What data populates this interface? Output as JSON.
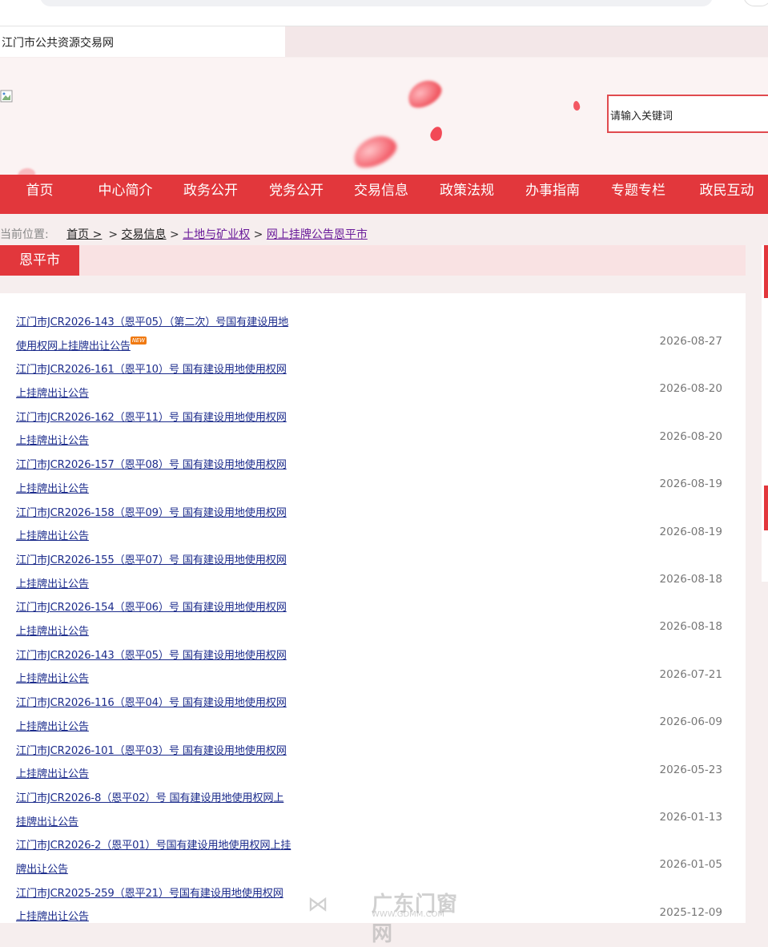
{
  "site": {
    "title": "江门市公共资源交易网"
  },
  "search": {
    "placeholder": "请输入关键词"
  },
  "nav": [
    {
      "label": "首页",
      "w": 99
    },
    {
      "label": "中心简介",
      "w": 115
    },
    {
      "label": "政务公开",
      "w": 98
    },
    {
      "label": "党务公开",
      "w": 116
    },
    {
      "label": "交易信息",
      "w": 96
    },
    {
      "label": "政策法规",
      "w": 118
    },
    {
      "label": "办事指南",
      "w": 96
    },
    {
      "label": "专题专栏",
      "w": 118
    },
    {
      "label": "政民互动",
      "w": 103
    }
  ],
  "breadcrumb": {
    "label": "当前位置:",
    "items": [
      "首页 >",
      "交易信息",
      "土地与矿业权",
      "网上挂牌公告",
      "恩平市"
    ],
    "seps": [
      "",
      "> ",
      " > ",
      " > "
    ]
  },
  "section": {
    "title": "恩平市"
  },
  "list": [
    {
      "title": "江门市JCR2026-143（恩平05）（第二次）号国有建设用地使用权网上挂牌出让公告",
      "date": "2026-08-27",
      "new": true
    },
    {
      "title": "江门市JCR2026-161（恩平10）号 国有建设用地使用权网上挂牌出让公告",
      "date": "2026-08-20"
    },
    {
      "title": "江门市JCR2026-162（恩平11）号 国有建设用地使用权网上挂牌出让公告",
      "date": "2026-08-20"
    },
    {
      "title": "江门市JCR2026-157（恩平08）号 国有建设用地使用权网上挂牌出让公告",
      "date": "2026-08-19"
    },
    {
      "title": "江门市JCR2026-158（恩平09）号 国有建设用地使用权网上挂牌出让公告",
      "date": "2026-08-19"
    },
    {
      "title": "江门市JCR2026-155（恩平07）号 国有建设用地使用权网上挂牌出让公告",
      "date": "2026-08-18"
    },
    {
      "title": "江门市JCR2026-154（恩平06）号 国有建设用地使用权网上挂牌出让公告",
      "date": "2026-08-18"
    },
    {
      "title": "江门市JCR2026-143（恩平05）号 国有建设用地使用权网上挂牌出让公告",
      "date": "2026-07-21"
    },
    {
      "title": "江门市JCR2026-116（恩平04）号 国有建设用地使用权网上挂牌出让公告",
      "date": "2026-06-09"
    },
    {
      "title": "江门市JCR2026-101（恩平03）号 国有建设用地使用权网上挂牌出让公告",
      "date": "2026-05-23"
    },
    {
      "title": "江门市JCR2026-8（恩平02）号 国有建设用地使用权网上挂牌出让公告",
      "date": "2026-01-13"
    },
    {
      "title": "江门市JCR2026-2（恩平01）号国有建设用地使用权网上挂牌出让公告",
      "date": "2026-01-05"
    },
    {
      "title": "江门市JCR2025-259（恩平21）号国有建设用地使用权网上挂牌出让公告",
      "date": "2025-12-09"
    }
  ],
  "badge": {
    "new_label": "NEW"
  },
  "watermark": {
    "brand": "广东门窗网",
    "url": "WWW.GDMM.COM"
  }
}
